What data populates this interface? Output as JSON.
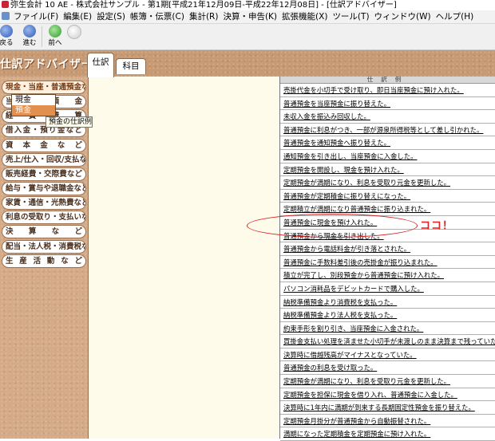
{
  "window": {
    "title": "弥生会計 10 AE - 株式会社サンプル - 第1期[平成21年12月09日-平成22年12月08日] - [仕訳アドバイザー]"
  },
  "menu": [
    "ファイル(F)",
    "編集(E)",
    "設定(S)",
    "帳簿・伝票(C)",
    "集計(R)",
    "決算・申告(K)",
    "拡張機能(X)",
    "ツール(T)",
    "ウィンドウ(W)",
    "ヘルプ(H)"
  ],
  "toolbar": {
    "back": "戻る",
    "forward": "進む",
    "home": "前へ"
  },
  "header": {
    "title": "仕訳アドバイザー",
    "tabs": [
      "仕訳",
      "科目"
    ]
  },
  "categories": [
    "現金・当座・普通預金など",
    "当座預金",
    "経費精算",
    "借入金・預り金など",
    "資本金など",
    "売上/仕入・回収/支払など",
    "販売経費・交際費など",
    "給与・賞与や退職金など",
    "家賃・通信・光熱費など",
    "利息の受取り・支払いなど",
    "決算など",
    "配当・法人税・消費税など",
    "生産活動など"
  ],
  "dropdown": {
    "items": [
      "現金",
      "預金"
    ],
    "selected": "預金",
    "tooltip": "預金の仕訳例"
  },
  "examples": {
    "header": "仕訳例",
    "rows": [
      "売掛代金を小切手で受け取り、即日当座預金に預け入れた。",
      "普通預金を当座預金に振り替えた。",
      "未収入金を振込み回収した。",
      "普通預金に利息がつき、一部が源泉所得税等として差し引かれた。",
      "普通預金を通知預金へ振り替えた。",
      "通知預金を引き出し、当座預金に入金した。",
      "定期預金を開設し、現金を預け入れた。",
      "定期預金が満期になり、利息を受取り元金を更新した。",
      "普通預金が定期積金に振り替えになった。",
      "定期積立が満期になり普通預金に振り込まれた。",
      "普通預金に現金を預け入れた。",
      "普通預金から現金を引き出した。",
      "普通預金から電話料金が引き落とされた。",
      "普通預金に手数料差引後の売掛金が振り込まれた。",
      "積立が完了し、別段預金から普通預金に預け入れた。",
      "パソコン消耗品をデビットカードで購入した。",
      "納税準備預金より消費税を支払った。",
      "納税準備預金より法人税を支払った。",
      "約束手形を割り引き、当座預金に入金された。",
      "買掛金支払い処理を済ませた小切手が未渡しのまま決算まで残っていた。",
      "決算時に借越残高がマイナスとなっていた。",
      "普通預金の利息を受け取った。",
      "定期預金が満期になり、利息を受取り元金を更新した。",
      "定期預金を担保に現金を借り入れ、普通預金に入金した。",
      "決算時に1年内に満期が到来する長期固定性預金を振り替えた。",
      "定期預金月掛分が普通預金から自動振替された。",
      "満期になった定期積金を定期預金に預け入れた。"
    ]
  },
  "annotation": {
    "text": "ココ！",
    "color": "#e02020"
  }
}
